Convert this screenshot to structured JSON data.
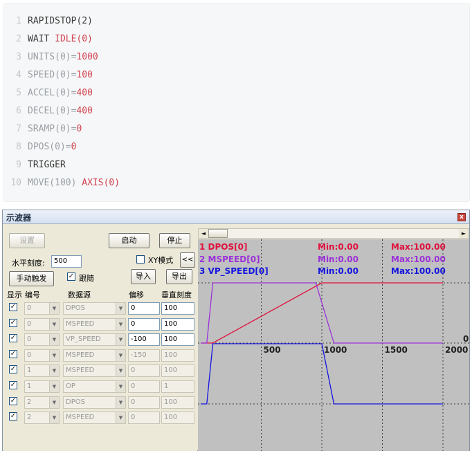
{
  "code": {
    "lines": [
      {
        "n": "1",
        "tokens": [
          {
            "t": "RAPIDSTOP(2)",
            "c": "plain"
          }
        ]
      },
      {
        "n": "2",
        "tokens": [
          {
            "t": "WAIT ",
            "c": "plain"
          },
          {
            "t": "IDLE(0)",
            "c": "red"
          }
        ]
      },
      {
        "n": "3",
        "tokens": [
          {
            "t": "UNITS(0)=",
            "c": "dim"
          },
          {
            "t": "1000",
            "c": "red"
          }
        ]
      },
      {
        "n": "4",
        "tokens": [
          {
            "t": "SPEED(0)=",
            "c": "dim"
          },
          {
            "t": "100",
            "c": "red"
          }
        ]
      },
      {
        "n": "5",
        "tokens": [
          {
            "t": "ACCEL(0)=",
            "c": "dim"
          },
          {
            "t": "400",
            "c": "red"
          }
        ]
      },
      {
        "n": "6",
        "tokens": [
          {
            "t": "DECEL(0)=",
            "c": "dim"
          },
          {
            "t": "400",
            "c": "red"
          }
        ]
      },
      {
        "n": "7",
        "tokens": [
          {
            "t": "SRAMP(0)=",
            "c": "dim"
          },
          {
            "t": "0",
            "c": "red"
          }
        ]
      },
      {
        "n": "8",
        "tokens": [
          {
            "t": "DPOS(0)=",
            "c": "dim"
          },
          {
            "t": "0",
            "c": "red"
          }
        ]
      },
      {
        "n": "9",
        "tokens": [
          {
            "t": "TRIGGER",
            "c": "plain"
          }
        ]
      },
      {
        "n": "10",
        "tokens": [
          {
            "t": "MOVE(100) ",
            "c": "dim"
          },
          {
            "t": "AXIS(0)",
            "c": "red"
          }
        ]
      }
    ]
  },
  "window": {
    "title": "示波器",
    "close_glyph": "x",
    "buttons": {
      "settings": "设置",
      "start": "启动",
      "stop": "停止",
      "manual_trigger": "手动触发",
      "import": "导入",
      "export": "导出",
      "collapse": "<<"
    },
    "horizontal_scale_label": "水平刻度:",
    "horizontal_scale_value": "500",
    "xy_mode_label": "XY模式",
    "xy_mode_checked": false,
    "follow_label": "跟随",
    "follow_checked": true,
    "columns": {
      "show": "显示",
      "id": "编号",
      "source": "数据源",
      "offset": "偏移",
      "vscale": "垂直刻度"
    },
    "channels": [
      {
        "show": true,
        "id": "0",
        "source": "DPOS",
        "offset": "0",
        "vscale": "100",
        "enabled": true
      },
      {
        "show": true,
        "id": "0",
        "source": "MSPEED",
        "offset": "0",
        "vscale": "100",
        "enabled": true
      },
      {
        "show": true,
        "id": "0",
        "source": "VP_SPEED",
        "offset": "-100",
        "vscale": "100",
        "enabled": true
      },
      {
        "show": true,
        "id": "0",
        "source": "MSPEED",
        "offset": "-150",
        "vscale": "100",
        "enabled": false
      },
      {
        "show": true,
        "id": "1",
        "source": "MSPEED",
        "offset": "0",
        "vscale": "100",
        "enabled": false
      },
      {
        "show": true,
        "id": "1",
        "source": "OP",
        "offset": "0",
        "vscale": "1",
        "enabled": false
      },
      {
        "show": true,
        "id": "2",
        "source": "DPOS",
        "offset": "0",
        "vscale": "100",
        "enabled": false
      },
      {
        "show": true,
        "id": "2",
        "source": "MSPEED",
        "offset": "0",
        "vscale": "100",
        "enabled": false
      }
    ],
    "scroll_left_glyph": "◄",
    "scroll_right_glyph": "►"
  },
  "chart_data": {
    "type": "line",
    "x_ticks": [
      "500",
      "1000",
      "1500",
      "2000"
    ],
    "zero_label": "0",
    "xlim": [
      0,
      2000
    ],
    "grid": true,
    "colors": {
      "dpos": "#e0103c",
      "mspeed": "#9b30d9",
      "vp_speed": "#1414e0"
    },
    "legend": [
      {
        "name": "1 DPOS[0]",
        "min": "Min:0.00",
        "max": "Max:100.00",
        "color": "#e0103c"
      },
      {
        "name": "2 MSPEED[0]",
        "min": "Min:0.00",
        "max": "Max:100.00",
        "color": "#9b30d9"
      },
      {
        "name": "3 VP_SPEED[0]",
        "min": "Min:0.00",
        "max": "Max:100.00",
        "color": "#1414e0"
      }
    ],
    "series": [
      {
        "name": "1 DPOS[0]",
        "color": "#e0103c",
        "points": [
          [
            0,
            0
          ],
          [
            100,
            0
          ],
          [
            1000,
            100
          ],
          [
            2000,
            100
          ]
        ]
      },
      {
        "name": "2 MSPEED[0]",
        "color": "#9b30d9",
        "points": [
          [
            0,
            0
          ],
          [
            50,
            0
          ],
          [
            100,
            100
          ],
          [
            950,
            100
          ],
          [
            1100,
            0
          ],
          [
            2000,
            0
          ]
        ]
      },
      {
        "name": "3 VP_SPEED[0]",
        "color": "#1414e0",
        "points": [
          [
            0,
            0
          ],
          [
            50,
            0
          ],
          [
            100,
            100
          ],
          [
            1000,
            100
          ],
          [
            1100,
            0
          ],
          [
            2000,
            0
          ]
        ]
      }
    ]
  }
}
